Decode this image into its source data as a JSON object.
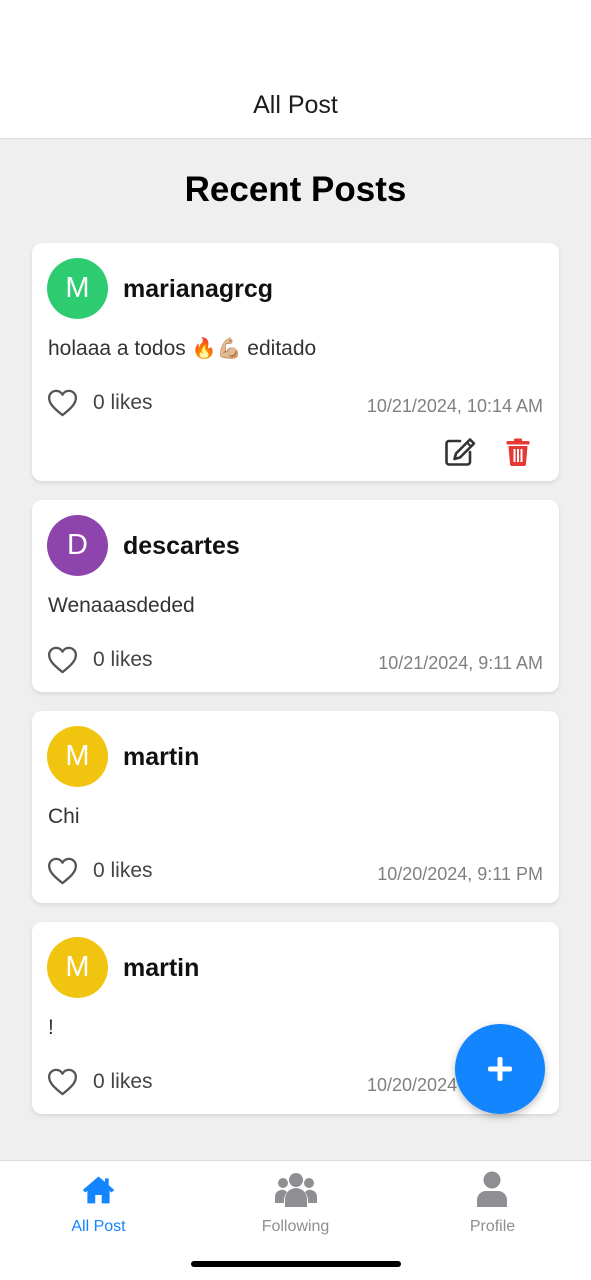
{
  "header": {
    "title": "All Post"
  },
  "section": {
    "title": "Recent Posts"
  },
  "posts": [
    {
      "avatar_letter": "M",
      "avatar_color": "#2ecc71",
      "username": "marianagrcg",
      "text": "holaaa a todos",
      "emoji": "🔥💪🏼",
      "text_suffix": "editado",
      "likes": "0 likes",
      "timestamp": "10/21/2024, 10:14 AM",
      "editable": true
    },
    {
      "avatar_letter": "D",
      "avatar_color": "#8e44ad",
      "username": "descartes",
      "text": "Wenaaasdeded",
      "likes": "0 likes",
      "timestamp": "10/21/2024, 9:11 AM"
    },
    {
      "avatar_letter": "M",
      "avatar_color": "#f1c40f",
      "username": "martin",
      "text": "Chi",
      "likes": "0 likes",
      "timestamp": "10/20/2024, 9:11 PM"
    },
    {
      "avatar_letter": "M",
      "avatar_color": "#f1c40f",
      "username": "martin",
      "text": "!",
      "likes": "0 likes",
      "timestamp": "10/20/2024"
    }
  ],
  "fab": {
    "icon": "plus-icon",
    "color": "#1385ff"
  },
  "tabs": [
    {
      "label": "All Post",
      "icon": "home-icon",
      "active": true
    },
    {
      "label": "Following",
      "icon": "users-icon",
      "active": false
    },
    {
      "label": "Profile",
      "icon": "user-icon",
      "active": false
    }
  ],
  "colors": {
    "accent": "#1385ff",
    "inactive": "#8e8e93",
    "delete": "#e53935"
  }
}
